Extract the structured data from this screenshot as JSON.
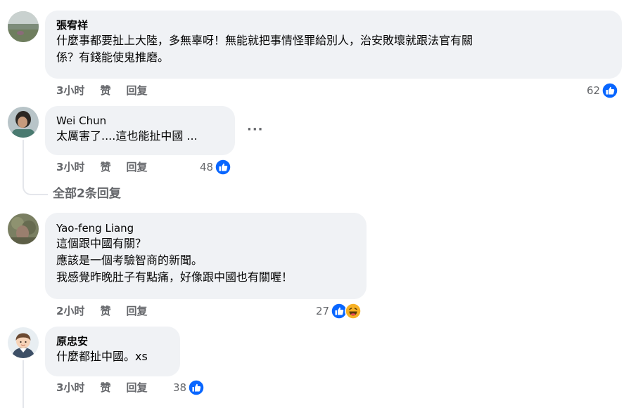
{
  "comments": [
    {
      "author": "張宥祥",
      "text": "什麼事都要扯上大陸，多無辜呀！無能就把事情怪罪給別人，治安敗壞就跟法官有關\n係？有錢能使鬼推磨。",
      "time": "3小时",
      "like_label": "赞",
      "reply_label": "回复",
      "reaction_count": "62",
      "reactions": [
        "like-icon"
      ]
    },
    {
      "author": "Wei Chun",
      "text": "太厲害了....這也能扯中國 ...",
      "time": "3小时",
      "like_label": "赞",
      "reply_label": "回复",
      "reaction_count": "48",
      "reactions": [
        "like-icon"
      ],
      "more_label": "···"
    },
    {
      "author": "Yao-feng Liang",
      "text": "這個跟中國有關？\n應該是一個考驗智商的新聞。\n我感覺昨晚肚子有點痛，好像跟中國也有關喔！",
      "time": "2小时",
      "like_label": "赞",
      "reply_label": "回复",
      "reaction_count": "27",
      "reactions": [
        "like-icon",
        "haha-icon"
      ]
    },
    {
      "author": "原忠安",
      "text": "什麼都扯中國。xs",
      "time": "3小时",
      "like_label": "赞",
      "reply_label": "回复",
      "reaction_count": "38",
      "reactions": [
        "like-icon"
      ]
    }
  ],
  "view_replies_label": "全部2条回复",
  "colors": {
    "bubble": "#f0f2f5",
    "meta_text": "#65676b",
    "like_blue": "#0866ff",
    "haha_yellow": "#f7b125",
    "thread_line": "#e4e6eb"
  }
}
